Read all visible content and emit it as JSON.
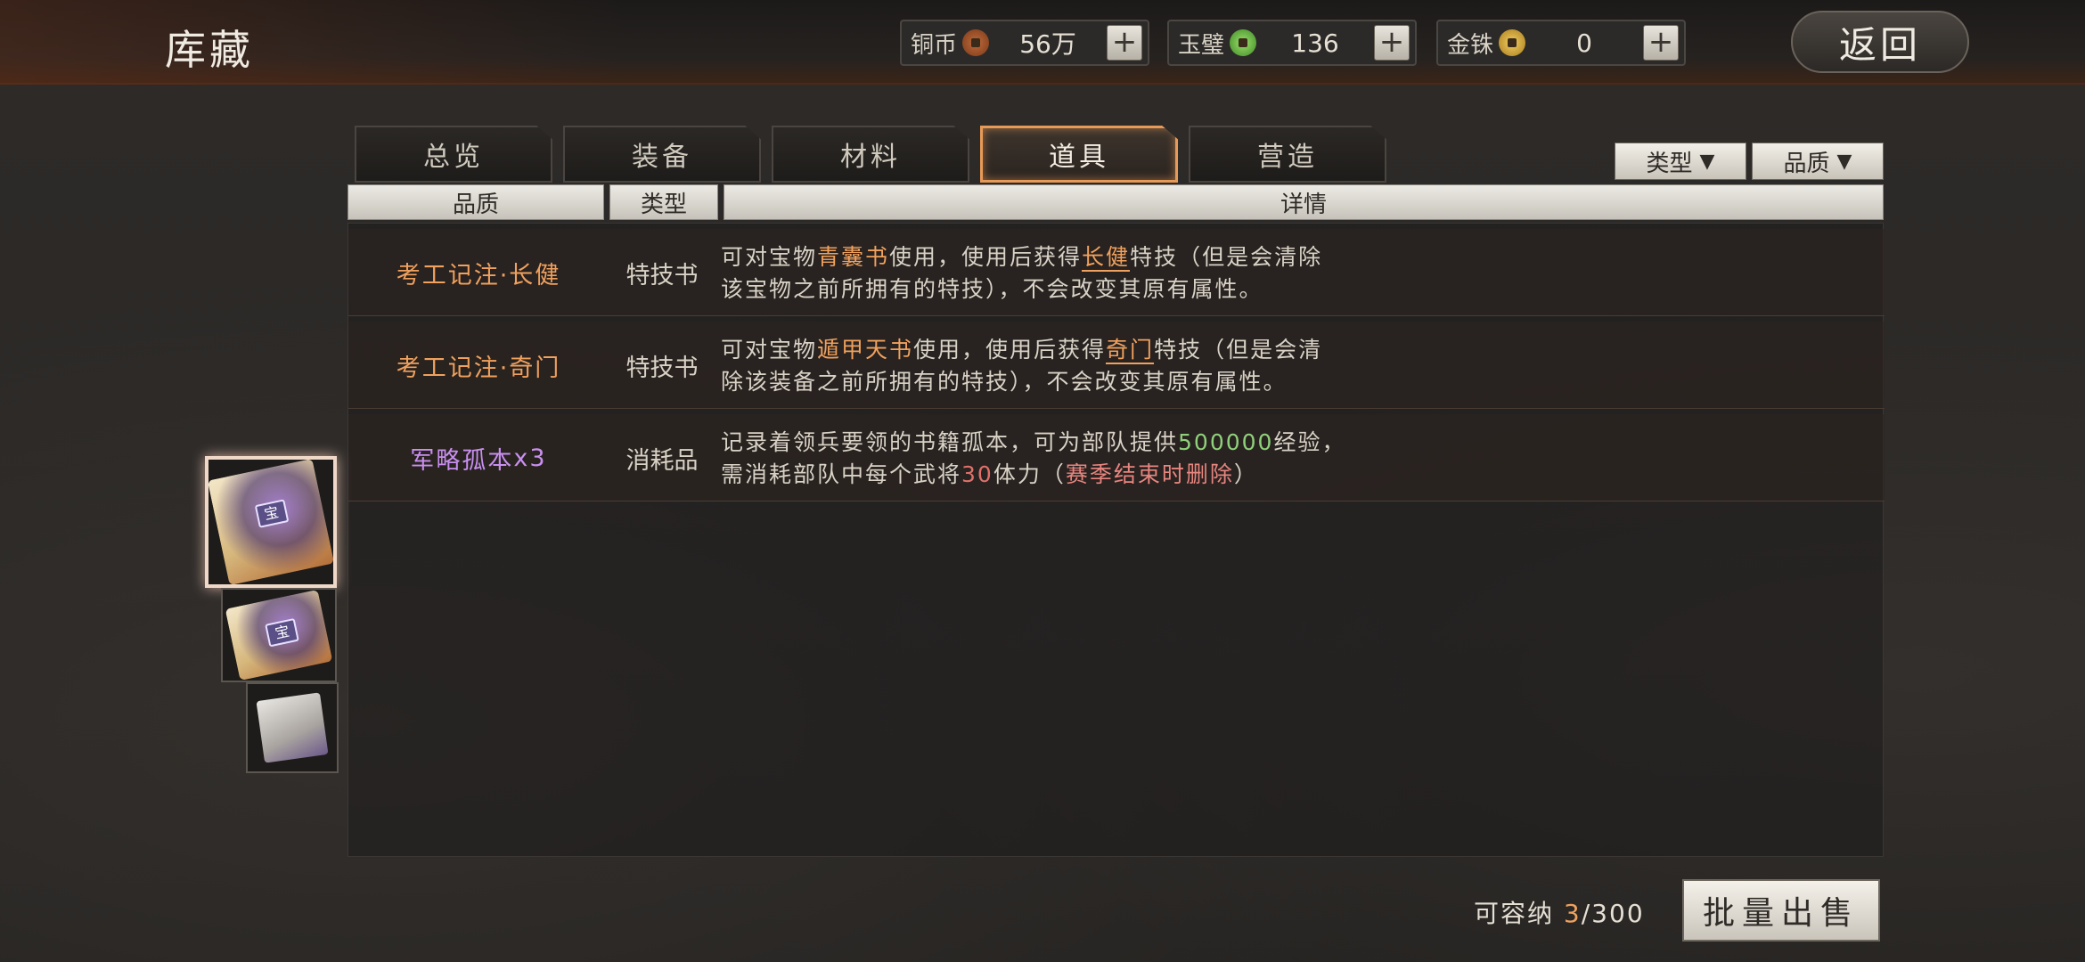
{
  "header": {
    "title": "库藏",
    "back_label": "返回",
    "currencies": [
      {
        "name": "铜币",
        "value": "56万",
        "icon": "copper-coin-icon"
      },
      {
        "name": "玉璧",
        "value": "136",
        "icon": "jade-disc-icon"
      },
      {
        "name": "金铢",
        "value": "0",
        "icon": "gold-coin-icon"
      }
    ],
    "plus_label": "+"
  },
  "tabs": [
    {
      "label": "总览",
      "active": false
    },
    {
      "label": "装备",
      "active": false
    },
    {
      "label": "材料",
      "active": false
    },
    {
      "label": "道具",
      "active": true
    },
    {
      "label": "营造",
      "active": false
    }
  ],
  "filters": {
    "type_label": "类型",
    "quality_label": "品质",
    "arrow": "▼"
  },
  "table": {
    "headers": {
      "quality": "品质",
      "type": "类型",
      "detail": "详情"
    },
    "rows": [
      {
        "name": "考工记注·长健",
        "name_color": "#f0a15d",
        "type": "特技书",
        "detail_parts": [
          "可对宝物",
          "青囊书",
          "使用，使用后获得",
          "长健",
          "特技（但是会清除",
          "该宝物之前所拥有的特技），不会改变其原有属性。"
        ]
      },
      {
        "name": "考工记注·奇门",
        "name_color": "#f0a15d",
        "type": "特技书",
        "detail_parts": [
          "可对宝物",
          "遁甲天书",
          "使用，使用后获得",
          "奇门",
          "特技（但是会清",
          "除该装备之前所拥有的特技），不会改变其原有属性。"
        ]
      },
      {
        "name": "军略孤本",
        "count": "x3",
        "name_color": "#c98ff0",
        "type": "消耗品",
        "detail_parts": [
          "记录着领兵要领的书籍孤本，可为部队提供",
          "500000",
          "经验，",
          "需消耗部队中每个武将",
          "30",
          "体力（",
          "赛季结束时删除",
          "）"
        ]
      }
    ]
  },
  "thumbnails": [
    {
      "name": "scroll-treasure-thumb",
      "selected": true
    },
    {
      "name": "scroll-treasure-thumb",
      "selected": false
    },
    {
      "name": "book-thumb",
      "selected": false
    }
  ],
  "footer": {
    "capacity_label": "可容纳",
    "capacity_used": "3",
    "capacity_total": "/300",
    "sell_label": "批量出售"
  }
}
